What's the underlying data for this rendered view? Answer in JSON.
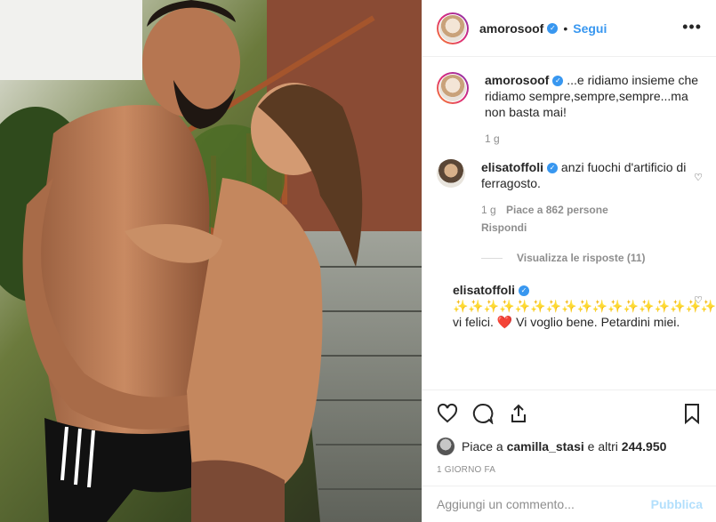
{
  "post": {
    "author": "amorosoof",
    "follow_label": "Segui",
    "separator": "•",
    "more_label": "•••"
  },
  "comments": [
    {
      "username": "amorosoof",
      "text": "...e ridiamo insieme che ridiamo sempre,sempre,sempre...ma non basta mai!",
      "time": "1 g"
    },
    {
      "username": "elisatoffoli",
      "text": "anzi fuochi d'artificio di ferragosto.",
      "time": "1 g",
      "likes": "Piace a 862 persone",
      "reply": "Rispondi",
      "view_replies": "Visualizza le risposte (11)"
    },
    {
      "username": "elisatoffoli",
      "text": "✨✨✨✨✨✨✨✨✨✨✨✨✨✨✨✨✨✨✨✨✨✨✨✨✨✨✨✨✨veder vi felici. ❤️ Vi voglio bene. Petardini miei."
    }
  ],
  "actions": {
    "liked_by_prefix": "Piace a ",
    "liked_by_user": "camilla_stasi",
    "liked_by_mid": " e altri ",
    "liked_by_count": "244.950",
    "date": "1 GIORNO FA"
  },
  "add_comment": {
    "placeholder": "Aggiungi un commento...",
    "publish_label": "Pubblica"
  },
  "colors": {
    "accent": "#3897f0",
    "publish_disabled": "#b2dffc",
    "muted": "#8e8e8e"
  }
}
